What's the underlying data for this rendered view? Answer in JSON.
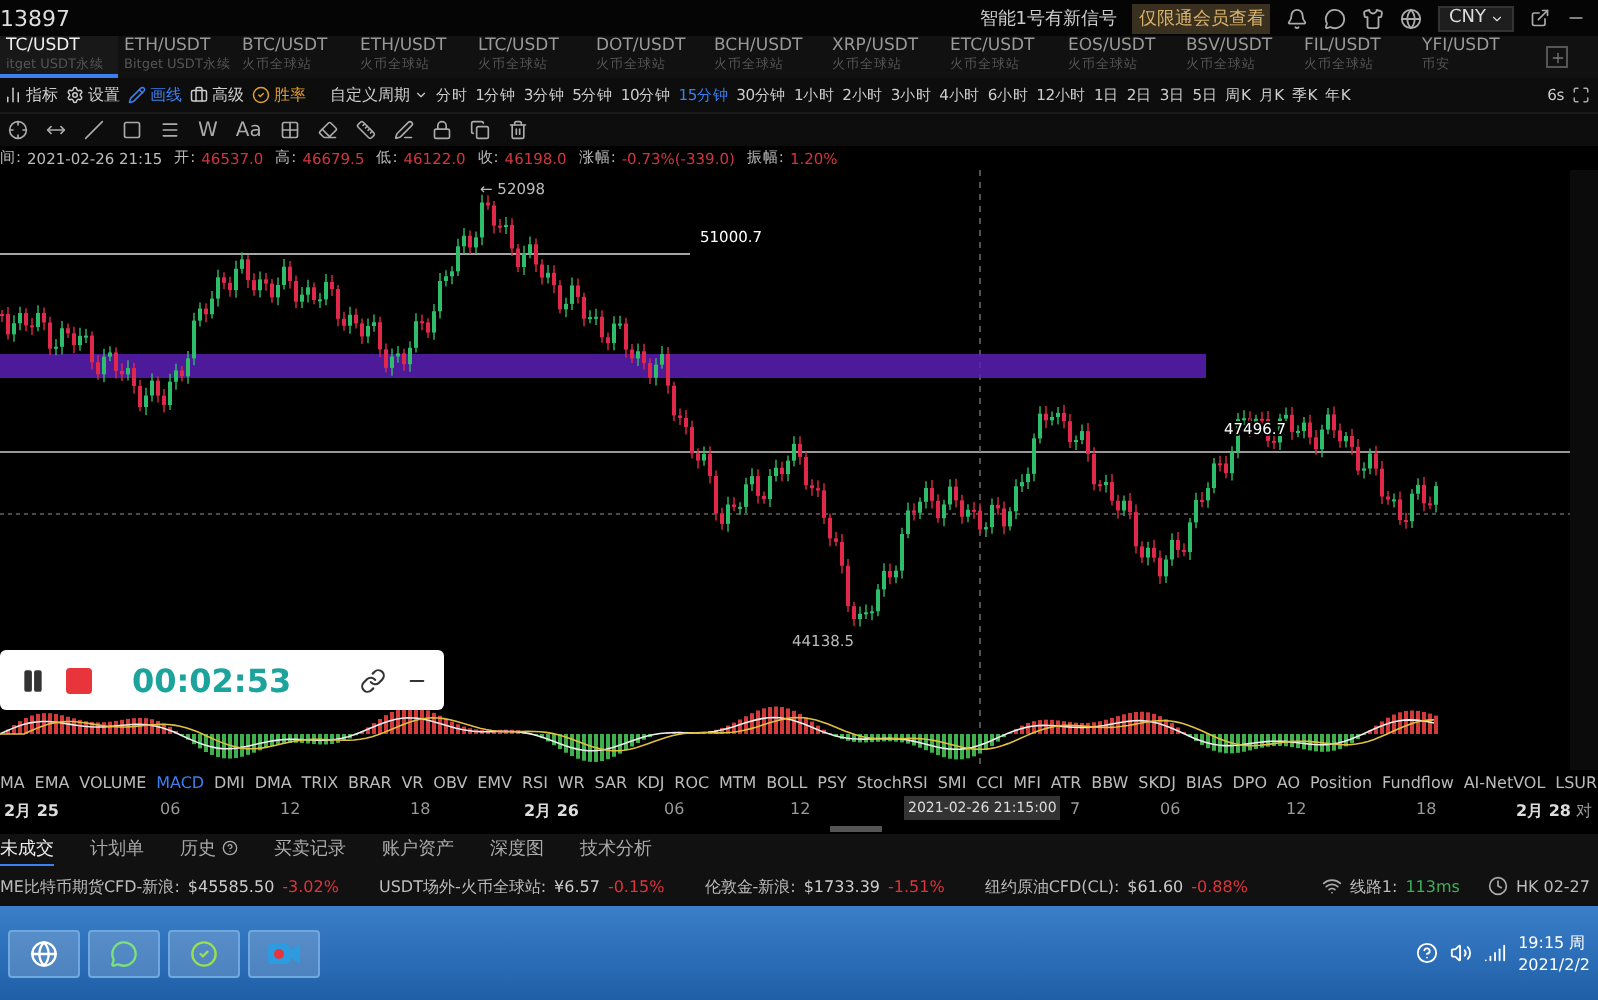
{
  "top_bar": {
    "account": "13897",
    "signal": "智能1号有新信号",
    "signal_note": "仅限通会员查看",
    "currency": "CNY"
  },
  "symbol_tabs": [
    {
      "pair": "TC/USDT",
      "exchange": "itget USDT永续",
      "selected": true
    },
    {
      "pair": "ETH/USDT",
      "exchange": "Bitget USDT永续",
      "selected": false
    },
    {
      "pair": "BTC/USDT",
      "exchange": "火币全球站",
      "selected": false
    },
    {
      "pair": "ETH/USDT",
      "exchange": "火币全球站",
      "selected": false
    },
    {
      "pair": "LTC/USDT",
      "exchange": "火币全球站",
      "selected": false
    },
    {
      "pair": "DOT/USDT",
      "exchange": "火币全球站",
      "selected": false
    },
    {
      "pair": "BCH/USDT",
      "exchange": "火币全球站",
      "selected": false
    },
    {
      "pair": "XRP/USDT",
      "exchange": "火币全球站",
      "selected": false
    },
    {
      "pair": "ETC/USDT",
      "exchange": "火币全球站",
      "selected": false
    },
    {
      "pair": "EOS/USDT",
      "exchange": "火币全球站",
      "selected": false
    },
    {
      "pair": "BSV/USDT",
      "exchange": "火币全球站",
      "selected": false
    },
    {
      "pair": "FIL/USDT",
      "exchange": "火币全球站",
      "selected": false
    },
    {
      "pair": "YFI/USDT",
      "exchange": "币安",
      "selected": false
    }
  ],
  "tools": [
    {
      "label": "指标",
      "kind": "indicator"
    },
    {
      "label": "设置",
      "kind": "settings"
    },
    {
      "label": "画线",
      "kind": "draw"
    },
    {
      "label": "高级",
      "kind": "advanced"
    },
    {
      "label": "胜率",
      "kind": "winrate"
    }
  ],
  "period_menu": "自定义周期",
  "periods": [
    {
      "label": "分时",
      "selected": false
    },
    {
      "label": "1分钟",
      "selected": false
    },
    {
      "label": "3分钟",
      "selected": false
    },
    {
      "label": "5分钟",
      "selected": false
    },
    {
      "label": "10分钟",
      "selected": false
    },
    {
      "label": "15分钟",
      "selected": true
    },
    {
      "label": "30分钟",
      "selected": false
    },
    {
      "label": "1小时",
      "selected": false
    },
    {
      "label": "2小时",
      "selected": false
    },
    {
      "label": "3小时",
      "selected": false
    },
    {
      "label": "4小时",
      "selected": false
    },
    {
      "label": "6小时",
      "selected": false
    },
    {
      "label": "12小时",
      "selected": false
    },
    {
      "label": "1日",
      "selected": false
    },
    {
      "label": "2日",
      "selected": false
    },
    {
      "label": "3日",
      "selected": false
    },
    {
      "label": "5日",
      "selected": false
    },
    {
      "label": "周K",
      "selected": false
    },
    {
      "label": "月K",
      "selected": false
    },
    {
      "label": "季K",
      "selected": false
    },
    {
      "label": "年K",
      "selected": false
    }
  ],
  "refresh": "6s",
  "draw_text_tools": [
    "W",
    "Aa"
  ],
  "ohlc": [
    {
      "label": "间:",
      "value": "2021-02-26 21:15",
      "kind": "time"
    },
    {
      "label": "开:",
      "value": "46537.0",
      "kind": "price"
    },
    {
      "label": "高:",
      "value": "46679.5",
      "kind": "price"
    },
    {
      "label": "低:",
      "value": "46122.0",
      "kind": "price"
    },
    {
      "label": "收:",
      "value": "46198.0",
      "kind": "price"
    },
    {
      "label": "涨幅:",
      "value": "-0.73%(-339.0)",
      "kind": "price"
    },
    {
      "label": "振幅:",
      "value": "1.20%",
      "kind": "price"
    }
  ],
  "chart": {
    "labels": [
      {
        "text": "← 52098",
        "kind": "high"
      },
      {
        "text": "51000.7",
        "kind": "line"
      },
      {
        "text": "47496.7",
        "kind": "line"
      },
      {
        "text": "44138.5",
        "kind": "low"
      }
    ]
  },
  "recorder": {
    "time": "00:02:53"
  },
  "indicators": [
    {
      "label": "MA",
      "selected": false
    },
    {
      "label": "EMA",
      "selected": false
    },
    {
      "label": "VOLUME",
      "selected": false
    },
    {
      "label": "MACD",
      "selected": true
    },
    {
      "label": "DMI",
      "selected": false
    },
    {
      "label": "DMA",
      "selected": false
    },
    {
      "label": "TRIX",
      "selected": false
    },
    {
      "label": "BRAR",
      "selected": false
    },
    {
      "label": "VR",
      "selected": false
    },
    {
      "label": "OBV",
      "selected": false
    },
    {
      "label": "EMV",
      "selected": false
    },
    {
      "label": "RSI",
      "selected": false
    },
    {
      "label": "WR",
      "selected": false
    },
    {
      "label": "SAR",
      "selected": false
    },
    {
      "label": "KDJ",
      "selected": false
    },
    {
      "label": "ROC",
      "selected": false
    },
    {
      "label": "MTM",
      "selected": false
    },
    {
      "label": "BOLL",
      "selected": false
    },
    {
      "label": "PSY",
      "selected": false
    },
    {
      "label": "StochRSI",
      "selected": false
    },
    {
      "label": "SMI",
      "selected": false
    },
    {
      "label": "CCI",
      "selected": false
    },
    {
      "label": "MFI",
      "selected": false
    },
    {
      "label": "ATR",
      "selected": false
    },
    {
      "label": "BBW",
      "selected": false
    },
    {
      "label": "SKDJ",
      "selected": false
    },
    {
      "label": "BIAS",
      "selected": false
    },
    {
      "label": "DPO",
      "selected": false
    },
    {
      "label": "AO",
      "selected": false
    },
    {
      "label": "Position",
      "selected": false
    },
    {
      "label": "Fundflow",
      "selected": false
    },
    {
      "label": "AI-NetVOL",
      "selected": false
    },
    {
      "label": "LSUR",
      "selected": false
    }
  ],
  "time_axis": [
    {
      "text": "2月 25",
      "kind": "day"
    },
    {
      "text": "06",
      "kind": "hour"
    },
    {
      "text": "12",
      "kind": "hour"
    },
    {
      "text": "18",
      "kind": "hour"
    },
    {
      "text": "2月 26",
      "kind": "day"
    },
    {
      "text": "06",
      "kind": "hour"
    },
    {
      "text": "12",
      "kind": "hour"
    },
    {
      "text": "7",
      "kind": "hour"
    },
    {
      "text": "06",
      "kind": "hour"
    },
    {
      "text": "12",
      "kind": "hour"
    },
    {
      "text": "18",
      "kind": "hour"
    },
    {
      "text": "2月 28",
      "kind": "day"
    },
    {
      "text": "对",
      "kind": "hour"
    }
  ],
  "crosshair_time": "2021-02-26 21:15:00",
  "bottom_tabs": [
    {
      "label": "未成交",
      "selected": true
    },
    {
      "label": "计划单",
      "selected": false
    },
    {
      "label": "历史",
      "selected": false
    },
    {
      "label": "买卖记录",
      "selected": false
    },
    {
      "label": "账户资产",
      "selected": false
    },
    {
      "label": "深度图",
      "selected": false
    },
    {
      "label": "技术分析",
      "selected": false
    }
  ],
  "tickers": [
    {
      "name": "ME比特币期货CFD-新浪:",
      "price": "$45585.50",
      "change": "-3.02%"
    },
    {
      "name": "USDT场外-火币全球站:",
      "price": "¥6.57",
      "change": "-0.15%"
    },
    {
      "name": "伦敦金-新浪:",
      "price": "$1733.39",
      "change": "-1.51%"
    },
    {
      "name": "纽约原油CFD(CL):",
      "price": "$61.60",
      "change": "-0.88%"
    }
  ],
  "status": {
    "line_label": "线路1:",
    "latency": "113ms",
    "clock": "HK 02-27"
  },
  "taskbar": {
    "time": "19:15 周",
    "date": "2021/2/2"
  }
}
